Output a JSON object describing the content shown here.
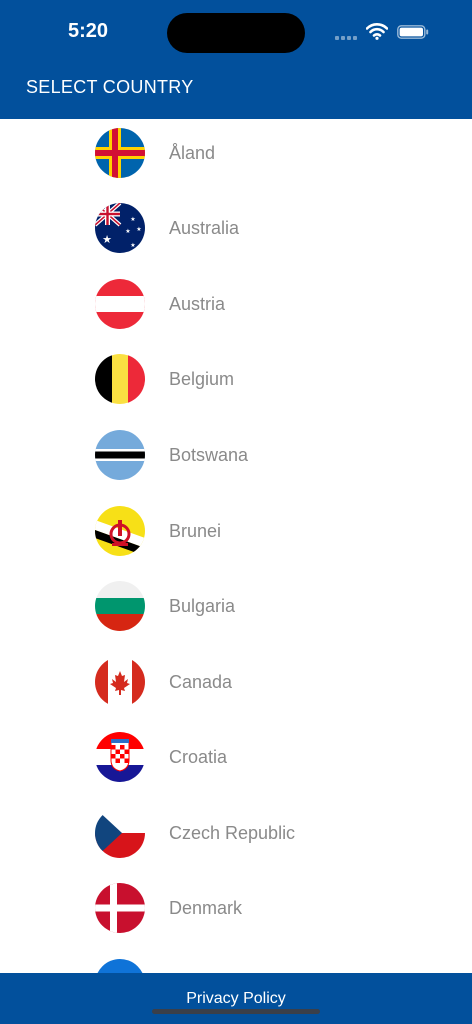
{
  "status_bar": {
    "time": "5:20"
  },
  "header": {
    "title": "SELECT COUNTRY"
  },
  "countries": [
    {
      "label": "Åland",
      "flag_icon": "aland-flag-icon"
    },
    {
      "label": "Australia",
      "flag_icon": "australia-flag-icon"
    },
    {
      "label": "Austria",
      "flag_icon": "austria-flag-icon"
    },
    {
      "label": "Belgium",
      "flag_icon": "belgium-flag-icon"
    },
    {
      "label": "Botswana",
      "flag_icon": "botswana-flag-icon"
    },
    {
      "label": "Brunei",
      "flag_icon": "brunei-flag-icon"
    },
    {
      "label": "Bulgaria",
      "flag_icon": "bulgaria-flag-icon"
    },
    {
      "label": "Canada",
      "flag_icon": "canada-flag-icon"
    },
    {
      "label": "Croatia",
      "flag_icon": "croatia-flag-icon"
    },
    {
      "label": "Czech Republic",
      "flag_icon": "czech-republic-flag-icon"
    },
    {
      "label": "Denmark",
      "flag_icon": "denmark-flag-icon"
    }
  ],
  "footer": {
    "privacy_policy_label": "Privacy Policy"
  },
  "colors": {
    "brand_blue": "#02509c",
    "row_text": "#8a8a8a"
  }
}
